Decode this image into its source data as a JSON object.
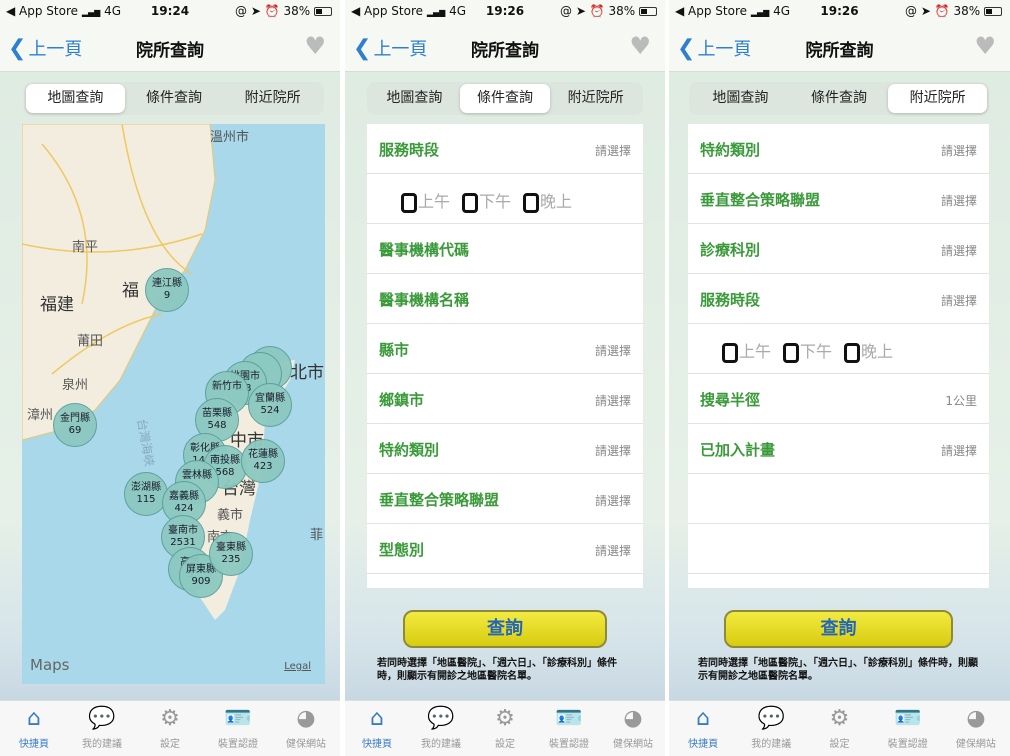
{
  "panels": [
    {
      "status": {
        "carrier": "◀ App Store",
        "signal": "▂▄▆",
        "network": "4G",
        "time": "19:24",
        "icons": "@ ➤ ⏰",
        "battery": "38%"
      }
    },
    {
      "status": {
        "carrier": "◀ App Store",
        "signal": "▂▄▆",
        "network": "4G",
        "time": "19:26",
        "icons": "@ ➤ ⏰",
        "battery": "38%"
      }
    },
    {
      "status": {
        "carrier": "◀ App Store",
        "signal": "▂▄▆",
        "network": "4G",
        "time": "19:26",
        "icons": "@ ➤ ⏰",
        "battery": "38%"
      }
    }
  ],
  "nav": {
    "back": "上一頁",
    "title": "院所查詢",
    "favorite_icon": "heart-icon"
  },
  "segments": [
    "地圖查詢",
    "條件查詢",
    "附近院所"
  ],
  "active_segments": [
    0,
    1,
    2
  ],
  "map": {
    "labels": [
      "溫州市",
      "南平",
      "福建",
      "福",
      "莆田",
      "泉州",
      "漳州",
      "台灣海峽",
      "北市",
      "中市",
      "台灣",
      "義市",
      "南市",
      "菲"
    ],
    "clusters": [
      {
        "name": "連江縣",
        "count": "9"
      },
      {
        "name": "金門縣",
        "count": "69"
      },
      {
        "name": "澎湖縣",
        "count": "115"
      },
      {
        "name": "桃園市",
        "count": "18"
      },
      {
        "name": "新竹市",
        "count": ""
      },
      {
        "name": "宜蘭縣",
        "count": "524"
      },
      {
        "name": "苗栗縣",
        "count": "548"
      },
      {
        "name": "彰化縣",
        "count": "1444"
      },
      {
        "name": "南投縣",
        "count": "568"
      },
      {
        "name": "花蓮縣",
        "count": "423"
      },
      {
        "name": "雲林縣",
        "count": ""
      },
      {
        "name": "嘉義縣",
        "count": "424"
      },
      {
        "name": "臺南市",
        "count": "2531"
      },
      {
        "name": "高雄",
        "count": "3"
      },
      {
        "name": "屏東縣",
        "count": "909"
      },
      {
        "name": "臺東縣",
        "count": "235"
      }
    ],
    "brand": "Maps",
    "legal": "Legal"
  },
  "condition_form": {
    "rows": [
      {
        "label": "服務時段",
        "value": "請選擇"
      },
      {
        "type": "checks"
      },
      {
        "label": "醫事機構代碼",
        "value": ""
      },
      {
        "label": "醫事機構名稱",
        "value": ""
      },
      {
        "label": "縣市",
        "value": "請選擇"
      },
      {
        "label": "鄉鎮市",
        "value": "請選擇"
      },
      {
        "label": "特約類別",
        "value": "請選擇"
      },
      {
        "label": "垂直整合策略聯盟",
        "value": "請選擇"
      },
      {
        "label": "型態別",
        "value": "請選擇"
      }
    ]
  },
  "nearby_form": {
    "rows": [
      {
        "label": "特約類別",
        "value": "請選擇"
      },
      {
        "label": "垂直整合策略聯盟",
        "value": "請選擇"
      },
      {
        "label": "診療科別",
        "value": "請選擇"
      },
      {
        "label": "服務時段",
        "value": "請選擇"
      },
      {
        "type": "checks"
      },
      {
        "label": "搜尋半徑",
        "value": "1公里"
      },
      {
        "label": "已加入計畫",
        "value": "請選擇"
      },
      {
        "label": "",
        "value": ""
      },
      {
        "label": "",
        "value": ""
      }
    ]
  },
  "checks": [
    "上午",
    "下午",
    "晚上"
  ],
  "query_button": "查詢",
  "note": "若同時選擇「地區醫院」、「週六日」、「診療科別」條件時，則顯示有開診之地區醫院名單。",
  "tabbar": [
    {
      "label": "快捷頁",
      "icon": "home-icon",
      "glyph": "⌂"
    },
    {
      "label": "我的建議",
      "icon": "chat-bubble-icon",
      "glyph": "💬"
    },
    {
      "label": "設定",
      "icon": "gear-icon",
      "glyph": "⚙"
    },
    {
      "label": "裝置認證",
      "icon": "id-card-icon",
      "glyph": "🪪"
    },
    {
      "label": "健保網站",
      "icon": "globe-icon",
      "glyph": "◕"
    }
  ],
  "colors": {
    "accent": "#3a7cc4",
    "label_green": "#3a9a3a",
    "button_yellow": "#e6dc1a",
    "sea": "#a8d8ea",
    "land": "#f3ede0",
    "cluster": "#8cc9c0"
  }
}
